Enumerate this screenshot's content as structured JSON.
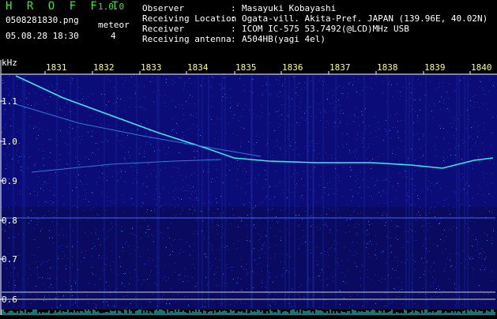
{
  "header": {
    "brand": "H R O F F T",
    "version": "1.0.0",
    "filename": "0508281830.png",
    "datetime": "05.08.28 18:30",
    "meteor_label": "meteor",
    "meteor_count": "4",
    "info": [
      {
        "key": "Observer",
        "value": "Masayuki Kobayashi"
      },
      {
        "key": "Receiving Location",
        "value": "Ogata-vill. Akita-Pref. JAPAN (139.96E, 40.02N)"
      },
      {
        "key": "Receiver",
        "value": "ICOM IC-575 53.7492(@LCD)MHz USB"
      },
      {
        "key": "Receiving antenna",
        "value": "A504HB(yagi 4el)"
      }
    ],
    "separator": ":"
  },
  "spectrogram": {
    "y_unit": "kHz",
    "y_ticks": [
      "1.1",
      "1.0",
      "0.9",
      "0.8",
      "0.7",
      "0.6"
    ],
    "x_ticks": [
      "1831",
      "1832",
      "1833",
      "1834",
      "1835",
      "1836",
      "1837",
      "1838",
      "1839",
      "1840"
    ],
    "colors": {
      "background": "#0a0a6e",
      "trace": "#39e6e6",
      "axis": "#ffffff",
      "time_label": "#ffff66"
    }
  }
}
